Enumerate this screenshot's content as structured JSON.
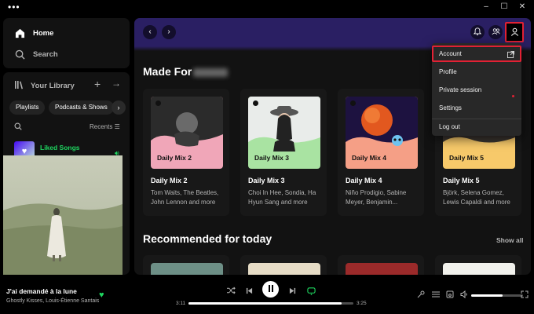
{
  "nav": {
    "home": "Home",
    "search": "Search"
  },
  "library": {
    "title": "Your Library",
    "chips": [
      "Playlists",
      "Podcasts & Shows"
    ],
    "sort_label": "Recents",
    "liked_songs": "Liked Songs"
  },
  "main": {
    "made_for_title": "Made For",
    "cards": [
      {
        "cover_label": "Daily Mix 2",
        "title": "Daily Mix 2",
        "desc": "Tom Waits, The Beatles, John Lennon and more",
        "color": "#f0a6b8"
      },
      {
        "cover_label": "Daily Mix 3",
        "title": "Daily Mix 3",
        "desc": "Choi In Hee, Sondia, Ha Hyun Sang and more",
        "color": "#a9e3a2"
      },
      {
        "cover_label": "Daily Mix 4",
        "title": "Daily Mix 4",
        "desc": "Niño Prodigio, Sabine Meyer, Benjamin...",
        "color": "#f59f86"
      },
      {
        "cover_label": "Daily Mix 5",
        "title": "Daily Mix 5",
        "desc": "Björk, Selena Gomez, Lewis Capaldi and more",
        "color": "#f7c96a"
      }
    ],
    "recommended_title": "Recommended for today",
    "show_all": "Show all"
  },
  "menu": {
    "items": [
      "Account",
      "Profile",
      "Private session",
      "Settings",
      "Log out"
    ]
  },
  "now_playing": {
    "title": "J'ai demandé à la lune",
    "artist": "Ghostly Kisses, Louis-Étienne Santais",
    "elapsed": "3:11",
    "duration": "3:25",
    "progress": 0.93,
    "volume": 0.6
  },
  "colors": {
    "accent_green": "#1ed760",
    "highlight_red": "#e22134",
    "header_purple": "#2a1f63"
  }
}
